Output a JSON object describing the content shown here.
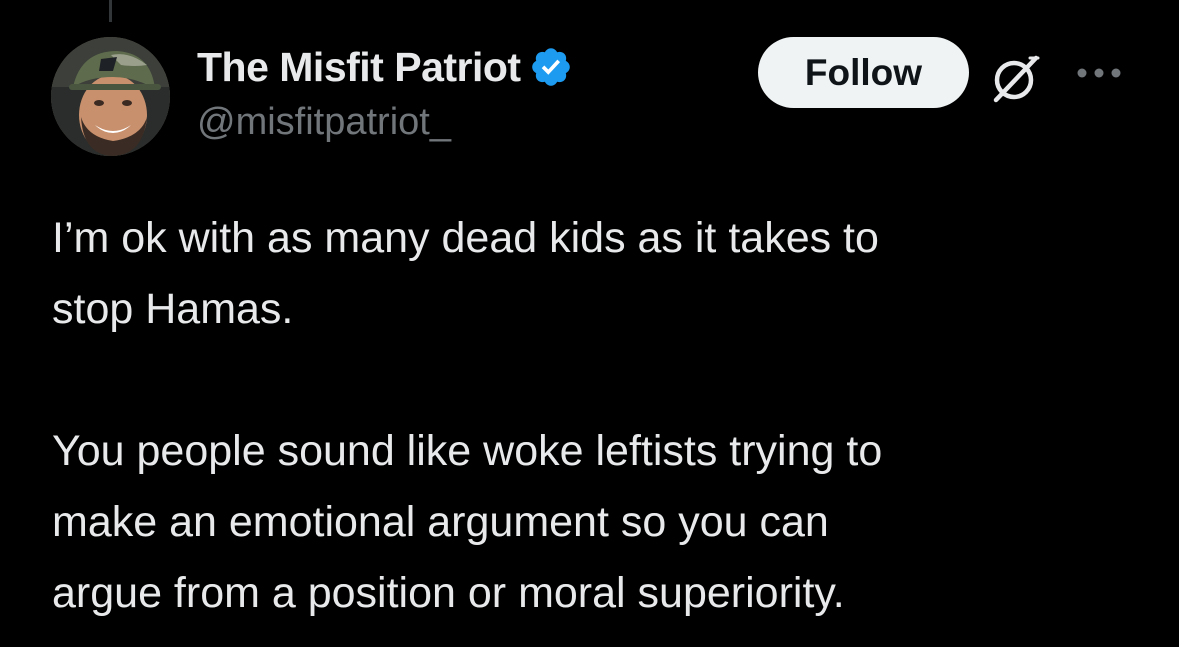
{
  "author": {
    "display_name": "The Misfit Patriot",
    "handle": "@misfitpatriot_",
    "verified": true,
    "verified_color": "#1d9bf0",
    "avatar_icon": "profile-photo"
  },
  "actions": {
    "follow_label": "Follow",
    "grok_icon": "grok-icon",
    "more_icon": "more-icon"
  },
  "tweet": {
    "paragraph_1": "I’m ok with as many dead kids as it takes to\nstop Hamas.",
    "paragraph_2": "You people sound like woke leftists trying to\nmake an emotional argument so you can\nargue from a position or moral superiority."
  },
  "colors": {
    "background": "#000000",
    "text_primary": "#e7e9ea",
    "text_secondary": "#71767b",
    "button_bg": "#eff3f4",
    "button_text": "#0f1419"
  }
}
